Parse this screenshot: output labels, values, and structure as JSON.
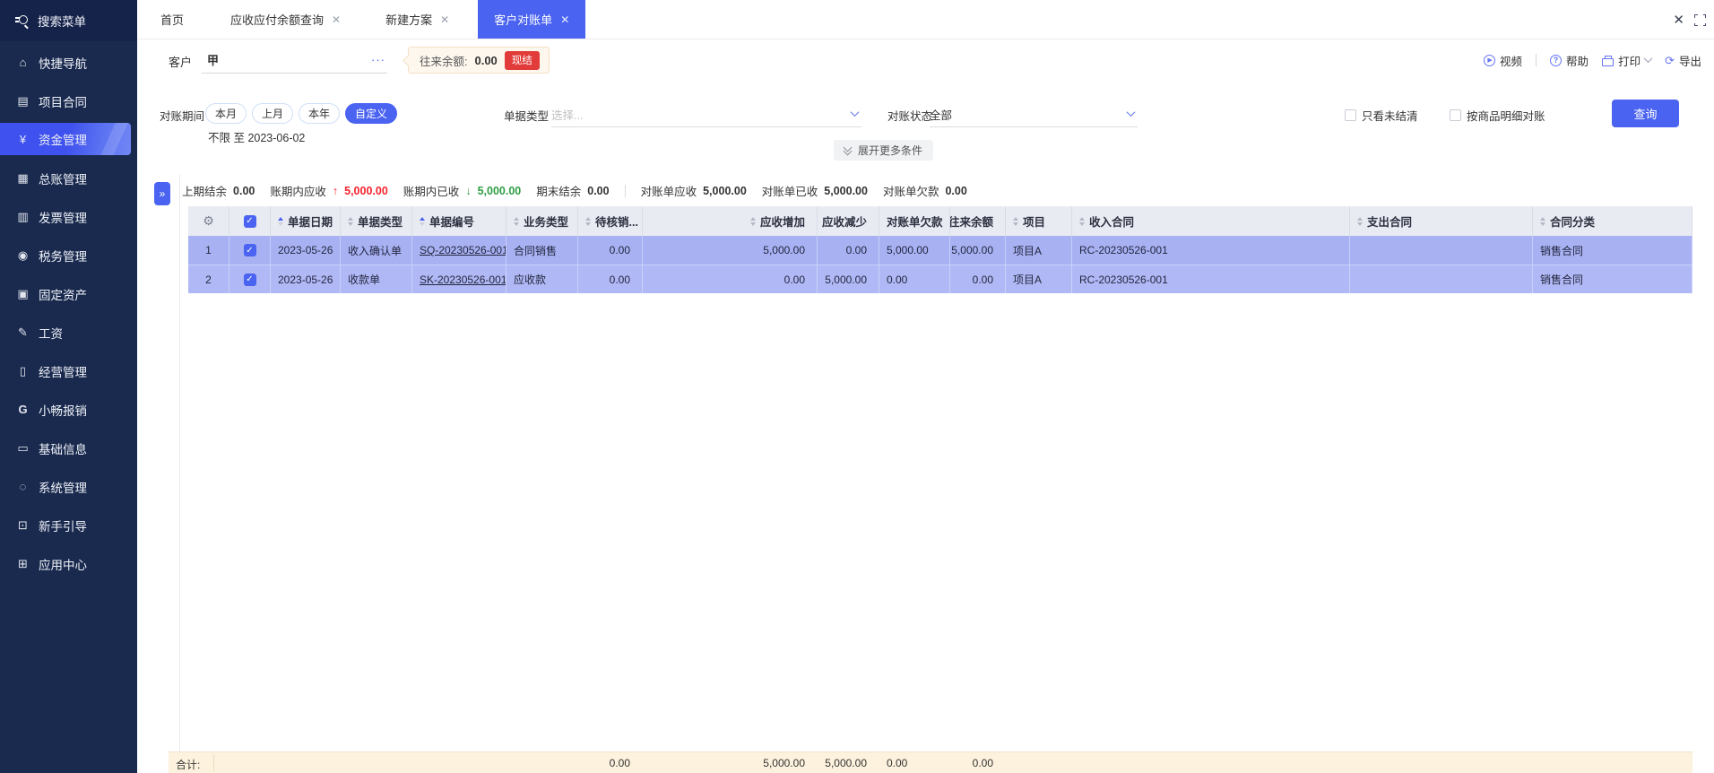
{
  "window": {
    "close_icon": "✕",
    "fullscreen_icon": "expand"
  },
  "sidebar": {
    "search_label": "搜索菜单",
    "items": [
      {
        "label": "快捷导航",
        "icon": "home-icon"
      },
      {
        "label": "项目合同",
        "icon": "contract-icon"
      },
      {
        "label": "资金管理",
        "icon": "money-bag-icon",
        "active": true
      },
      {
        "label": "总账管理",
        "icon": "ledger-icon"
      },
      {
        "label": "发票管理",
        "icon": "invoice-icon"
      },
      {
        "label": "税务管理",
        "icon": "tax-icon"
      },
      {
        "label": "固定资产",
        "icon": "building-icon"
      },
      {
        "label": "工资",
        "icon": "salary-icon"
      },
      {
        "label": "经营管理",
        "icon": "clipboard-icon"
      },
      {
        "label": "小畅报销",
        "icon": "g-logo-icon"
      },
      {
        "label": "基础信息",
        "icon": "id-card-icon"
      },
      {
        "label": "系统管理",
        "icon": "system-icon"
      },
      {
        "label": "新手引导",
        "icon": "guide-icon"
      },
      {
        "label": "应用中心",
        "icon": "app-center-icon"
      }
    ]
  },
  "tabs": [
    {
      "label": "首页",
      "closable": false
    },
    {
      "label": "应收应付余额查询",
      "closable": true
    },
    {
      "label": "新建方案",
      "closable": true
    },
    {
      "label": "客户对账单",
      "closable": true,
      "active": true
    }
  ],
  "toolbar": {
    "video": "视频",
    "help": "帮助",
    "print": "打印",
    "export": "导出"
  },
  "customer": {
    "label": "客户",
    "value": "甲",
    "more": "···",
    "balance_label": "往来余额:",
    "balance_value": "0.00",
    "badge": "现结"
  },
  "filters": {
    "period_label": "对账期间",
    "period_options": [
      "本月",
      "上月",
      "本年",
      "自定义"
    ],
    "period_active": "自定义",
    "period_range": "不限 至 2023-06-02",
    "doc_type_label": "单据类型",
    "doc_type_placeholder": "选择...",
    "status_label": "对账状态",
    "status_value": "全部",
    "checkbox_unsettled": "只看未结清",
    "checkbox_by_product": "按商品明细对账",
    "query_button": "查询",
    "expand_more": "展开更多条件"
  },
  "summary": {
    "items": [
      {
        "label": "上期结余",
        "value": "0.00"
      },
      {
        "label": "账期内应收",
        "arrow": "↑",
        "value": "5,000.00",
        "color": "#f5222d"
      },
      {
        "label": "账期内已收",
        "arrow": "↓",
        "value": "5,000.00",
        "color": "#2f9e44"
      },
      {
        "label": "期末结余",
        "value": "0.00"
      },
      {
        "label": "对账单应收",
        "value": "5,000.00"
      },
      {
        "label": "对账单已收",
        "value": "5,000.00"
      },
      {
        "label": "对账单欠款",
        "value": "0.00"
      }
    ]
  },
  "table": {
    "columns": [
      "单据日期",
      "单据类型",
      "单据编号",
      "业务类型",
      "待核销...",
      "应收增加",
      "应收减少",
      "对账单欠款",
      "往来余额",
      "项目",
      "收入合同",
      "支出合同",
      "合同分类"
    ],
    "rows": [
      {
        "index": "1",
        "date": "2023-05-26",
        "doc_type": "收入确认单",
        "doc_no": "SQ-20230526-001",
        "biz_type": "合同销售",
        "pending": "0.00",
        "ar_increase": "5,000.00",
        "ar_decrease": "0.00",
        "statement_debt": "5,000.00",
        "balance": "5,000.00",
        "project": "项目A",
        "income_contract": "RC-20230526-001",
        "expense_contract": "",
        "contract_category": "销售合同"
      },
      {
        "index": "2",
        "date": "2023-05-26",
        "doc_type": "收款单",
        "doc_no": "SK-20230526-001",
        "biz_type": "应收款",
        "pending": "0.00",
        "ar_increase": "0.00",
        "ar_decrease": "5,000.00",
        "statement_debt": "0.00",
        "balance": "0.00",
        "project": "项目A",
        "income_contract": "RC-20230526-001",
        "expense_contract": "",
        "contract_category": "销售合同"
      }
    ],
    "total": {
      "label": "合计:",
      "pending": "0.00",
      "ar_increase": "5,000.00",
      "ar_decrease": "5,000.00",
      "statement_debt": "0.00",
      "balance": "0.00"
    }
  },
  "colors": {
    "accent": "#4a63f1",
    "sidebar_bg": "#1a2a4e",
    "badge_red": "#e13c39",
    "increase_red": "#f5222d",
    "decrease_green": "#2f9e44",
    "row_selected_1": "#a8b2f3",
    "row_selected_2": "#b0b9f5",
    "header_bg": "#e9ebf3",
    "total_bg": "#fdf2de"
  }
}
